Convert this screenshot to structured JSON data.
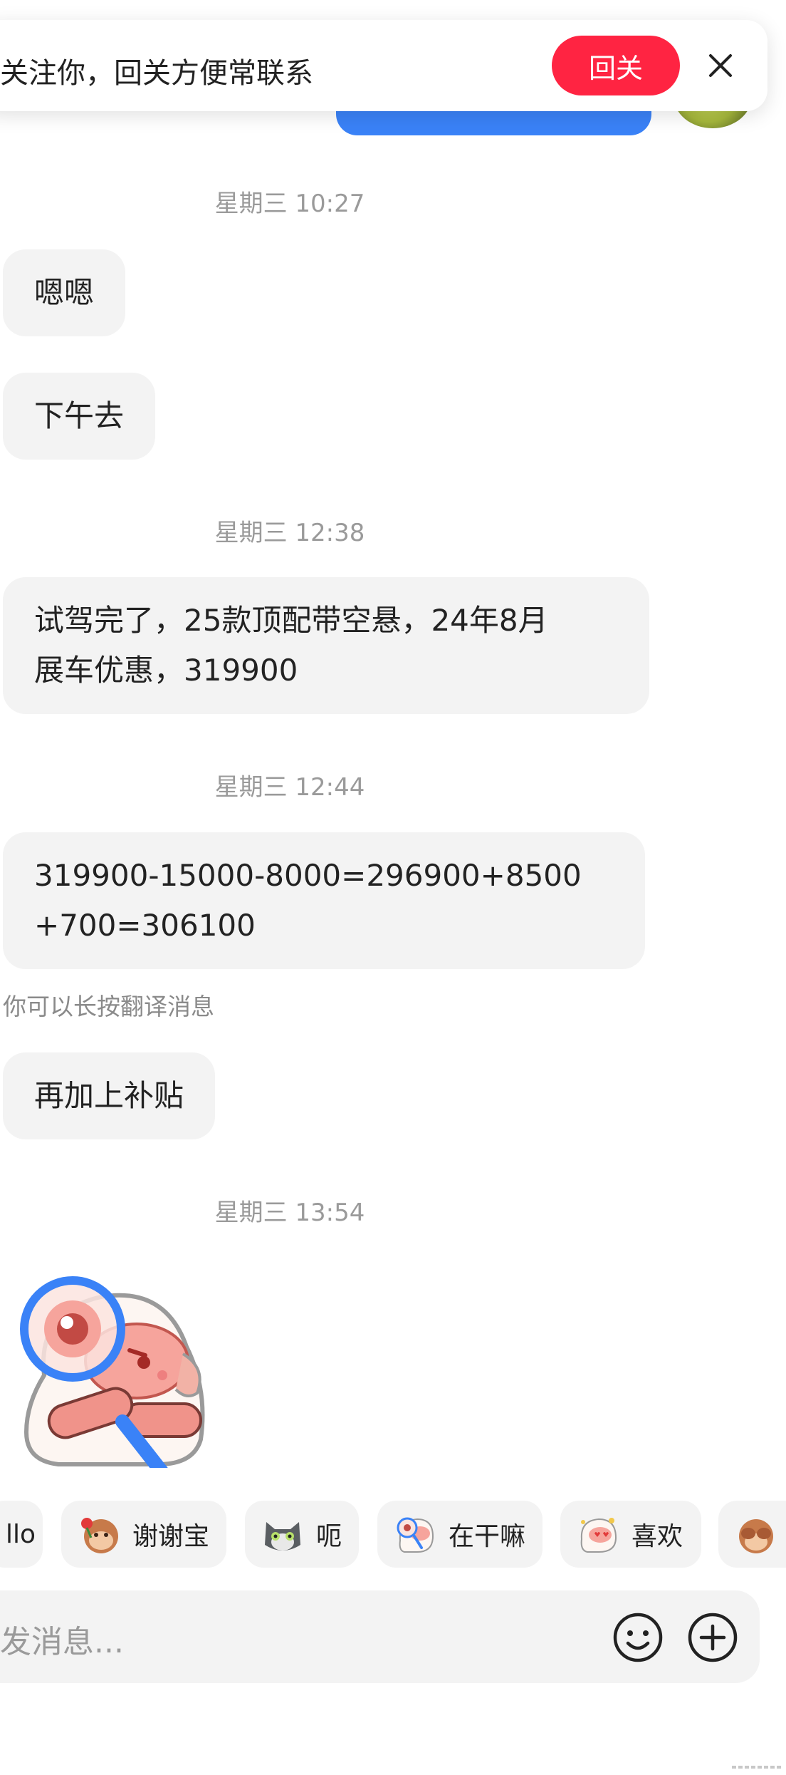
{
  "banner": {
    "text": "关注你，回关方便常联系",
    "follow_label": "回关",
    "close_icon": "close-icon"
  },
  "messages": [
    {
      "type": "time",
      "text": "星期三 10:27"
    },
    {
      "type": "bubble",
      "text": "嗯嗯"
    },
    {
      "type": "bubble",
      "text": "下午去"
    },
    {
      "type": "time",
      "text": "星期三 12:38"
    },
    {
      "type": "bubble",
      "lines": [
        "试驾完了，25款顶配带空悬，24年8月",
        "展车优惠，319900"
      ]
    },
    {
      "type": "time",
      "text": "星期三 12:44"
    },
    {
      "type": "bubble",
      "lines": [
        "319900-15000-8000=296900+8500",
        "+700=306100"
      ]
    },
    {
      "type": "hint",
      "text": "你可以长按翻译消息"
    },
    {
      "type": "bubble",
      "text": "再加上补贴"
    },
    {
      "type": "time",
      "text": "星期三 13:54"
    },
    {
      "type": "sticker",
      "icon": "magnifier-sheep-sticker"
    }
  ],
  "quick_replies": [
    {
      "label": "llo",
      "icon": ""
    },
    {
      "label": "谢谢宝",
      "icon": "monkey-rose-icon"
    },
    {
      "label": "呃",
      "icon": "gray-cat-icon"
    },
    {
      "label": "在干嘛",
      "icon": "magnifier-sheep-icon"
    },
    {
      "label": "喜欢",
      "icon": "heart-sheep-icon"
    },
    {
      "label": "",
      "icon": "monkey-cover-eyes-icon"
    }
  ],
  "input": {
    "placeholder": "发消息...",
    "emoji_icon": "smiley-icon",
    "plus_icon": "plus-circle-icon"
  },
  "colors": {
    "accent": "#ff2442",
    "my_bubble": "#3a82f7",
    "other_bubble": "#f3f3f3",
    "timestamp": "#9a9a9a"
  }
}
